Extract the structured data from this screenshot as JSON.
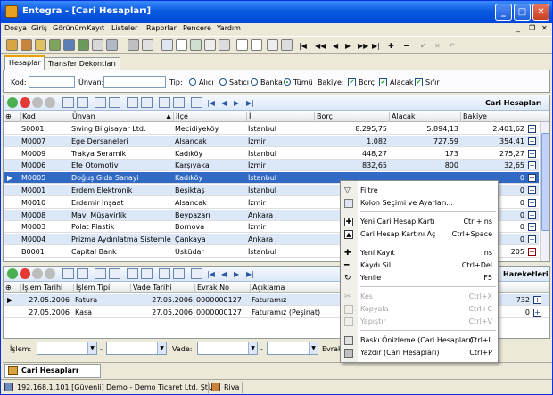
{
  "window": {
    "title": "Entegra - [Cari Hesapları]",
    "min": "_",
    "max": "□",
    "close": "✕"
  },
  "menu": [
    "Dosya",
    "Giriş",
    "Görünüm",
    "Kayıt",
    "Listeler",
    "Raporlar",
    "Pencere",
    "Yardım"
  ],
  "mdi_controls": {
    "min": "_",
    "restore": "❐",
    "close": "✕"
  },
  "toolbar": {
    "nav": [
      "|◀",
      "◀◀",
      "◀",
      "▶",
      "▶▶",
      "▶|",
      "✚",
      "━",
      "✔",
      "✕",
      "↶"
    ]
  },
  "tabs": [
    "Hesaplar",
    "Transfer Dekontları"
  ],
  "filter": {
    "kod": "Kod:",
    "unvan": "Ünvan:",
    "tip": "Tip:",
    "alici": "Alıcı",
    "satici": "Satıcı",
    "banka": "Banka",
    "tumu": "Tümü",
    "bakiye": "Bakiye:",
    "borc": "Borç",
    "alacak": "Alacak",
    "sifir": "Sıfır"
  },
  "grid1": {
    "title": "Cari Hesapları",
    "headers": [
      "Kod",
      "Ünvan",
      "İlçe",
      "İl",
      "Borç",
      "Alacak",
      "Bakiye"
    ],
    "rows": [
      {
        "kod": "S0001",
        "unvan": "Swing Bilgisayar Ltd.",
        "ilce": "Mecidiyeköy",
        "il": "İstanbul",
        "borc": "8.295,75",
        "alacak": "5.894,13",
        "bakiye": "2.401,62"
      },
      {
        "kod": "M0007",
        "unvan": "Ege Dersaneleri",
        "ilce": "Alsancak",
        "il": "İzmir",
        "borc": "1.082",
        "alacak": "727,59",
        "bakiye": "354,41"
      },
      {
        "kod": "M0009",
        "unvan": "Trakya Seramik",
        "ilce": "Kadıköy",
        "il": "İstanbul",
        "borc": "448,27",
        "alacak": "173",
        "bakiye": "275,27"
      },
      {
        "kod": "M0006",
        "unvan": "Efe Otomotiv",
        "ilce": "Karşıyaka",
        "il": "İzmir",
        "borc": "832,65",
        "alacak": "800",
        "bakiye": "32,65"
      },
      {
        "kod": "M0005",
        "unvan": "Doğuş Gıda Sanayi",
        "ilce": "Kadıköy",
        "il": "İstanbul",
        "borc": "",
        "alacak": "",
        "bakiye": "0"
      },
      {
        "kod": "M0001",
        "unvan": "Erdem Elektronik",
        "ilce": "Beşiktaş",
        "il": "İstanbul",
        "borc": "",
        "alacak": "",
        "bakiye": "0"
      },
      {
        "kod": "M0010",
        "unvan": "Erdemir İnşaat",
        "ilce": "Alsancak",
        "il": "İzmir",
        "borc": "",
        "alacak": "",
        "bakiye": "0"
      },
      {
        "kod": "M0008",
        "unvan": "Mavi Müşavirlik",
        "ilce": "Beypazarı",
        "il": "Ankara",
        "borc": "",
        "alacak": "",
        "bakiye": "0"
      },
      {
        "kod": "M0003",
        "unvan": "Polat Plastik",
        "ilce": "Bornova",
        "il": "İzmir",
        "borc": "",
        "alacak": "",
        "bakiye": "0"
      },
      {
        "kod": "M0004",
        "unvan": "Prizma Aydınlatma Sistemleri",
        "ilce": "Çankaya",
        "il": "Ankara",
        "borc": "",
        "alacak": "",
        "bakiye": "0"
      },
      {
        "kod": "B0001",
        "unvan": "Capital Bank",
        "ilce": "Üsküdar",
        "il": "İstanbul",
        "borc": "",
        "alacak": "",
        "bakiye": "205"
      }
    ]
  },
  "grid2": {
    "title": "Hareketleri",
    "headers": [
      "İşlem Tarihi",
      "İşlem Tipi",
      "Vade Tarihi",
      "Evrak No",
      "Açıklama"
    ],
    "rows": [
      {
        "tarih": "27.05.2006",
        "tip": "Fatura",
        "vade": "27.05.2006",
        "evrak": "0000000127",
        "aciklama": "Faturamız",
        "tutar": "732"
      },
      {
        "tarih": "27.05.2006",
        "tip": "Kasa",
        "vade": "27.05.2006",
        "evrak": "0000000127",
        "aciklama": "Faturamız (Peşinat)",
        "tutar": "0"
      }
    ]
  },
  "context_menu": {
    "items": [
      {
        "label": "Filtre",
        "shortcut": ""
      },
      {
        "label": "Kolon Seçimi ve Ayarları...",
        "shortcut": ""
      },
      {
        "label": "Yeni Cari Hesap Kartı",
        "shortcut": "Ctrl+Ins"
      },
      {
        "label": "Cari Hesap Kartını Aç",
        "shortcut": "Ctrl+Space"
      },
      {
        "label": "Yeni Kayıt",
        "shortcut": "Ins"
      },
      {
        "label": "Kaydı Sil",
        "shortcut": "Ctrl+Del"
      },
      {
        "label": "Yenile",
        "shortcut": "F5"
      },
      {
        "label": "Kes",
        "shortcut": "Ctrl+X"
      },
      {
        "label": "Kopyala",
        "shortcut": "Ctrl+C"
      },
      {
        "label": "Yapıştır",
        "shortcut": "Ctrl+V"
      },
      {
        "label": "Baskı Önizleme (Cari Hesapları)",
        "shortcut": "Ctrl+L"
      },
      {
        "label": "Yazdır (Cari Hesapları)",
        "shortcut": "Ctrl+P"
      }
    ]
  },
  "bottom_filter": {
    "islem": "İşlem:",
    "vade": "Vade:",
    "evrak": "Evrak:",
    "date_placeholder": ". .",
    "dash": "-"
  },
  "doc_tab": "Cari Hesapları",
  "status": {
    "ip": "192.168.1.101 [Güvenli]",
    "company": "Demo - Demo Ticaret Ltd. Şti.",
    "user": "Riva"
  }
}
